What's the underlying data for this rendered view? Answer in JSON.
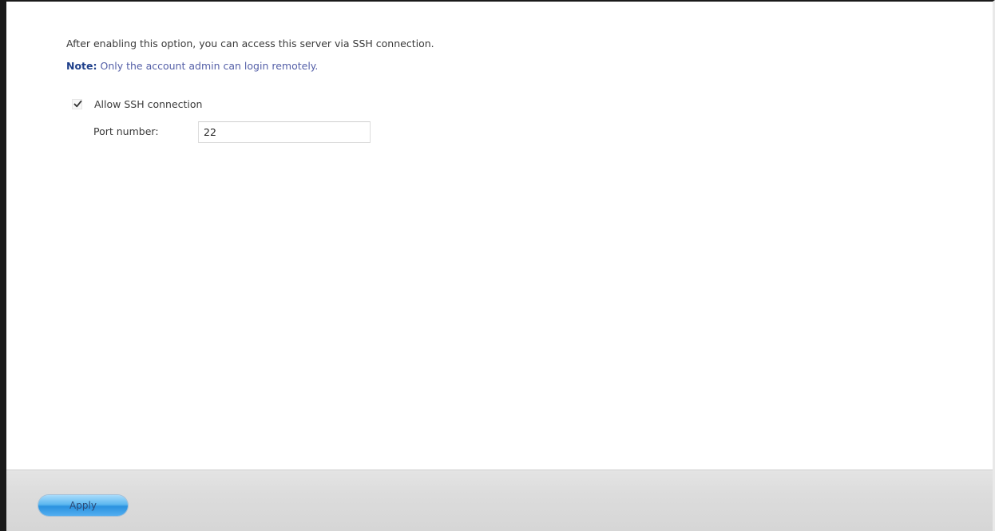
{
  "description": "After enabling this option, you can access this server via SSH connection.",
  "note": {
    "label": "Note:",
    "text": " Only the account admin can login remotely."
  },
  "ssh": {
    "allow_label": "Allow SSH connection",
    "allow_checked": true,
    "port_label": "Port number:",
    "port_value": "22"
  },
  "footer": {
    "apply_label": "Apply"
  },
  "icons": {
    "checkbox_check": "checkmark-icon"
  },
  "colors": {
    "note_label": "#1e3f8a",
    "note_text": "#5560a8",
    "apply_button": "#3a9fe6"
  }
}
